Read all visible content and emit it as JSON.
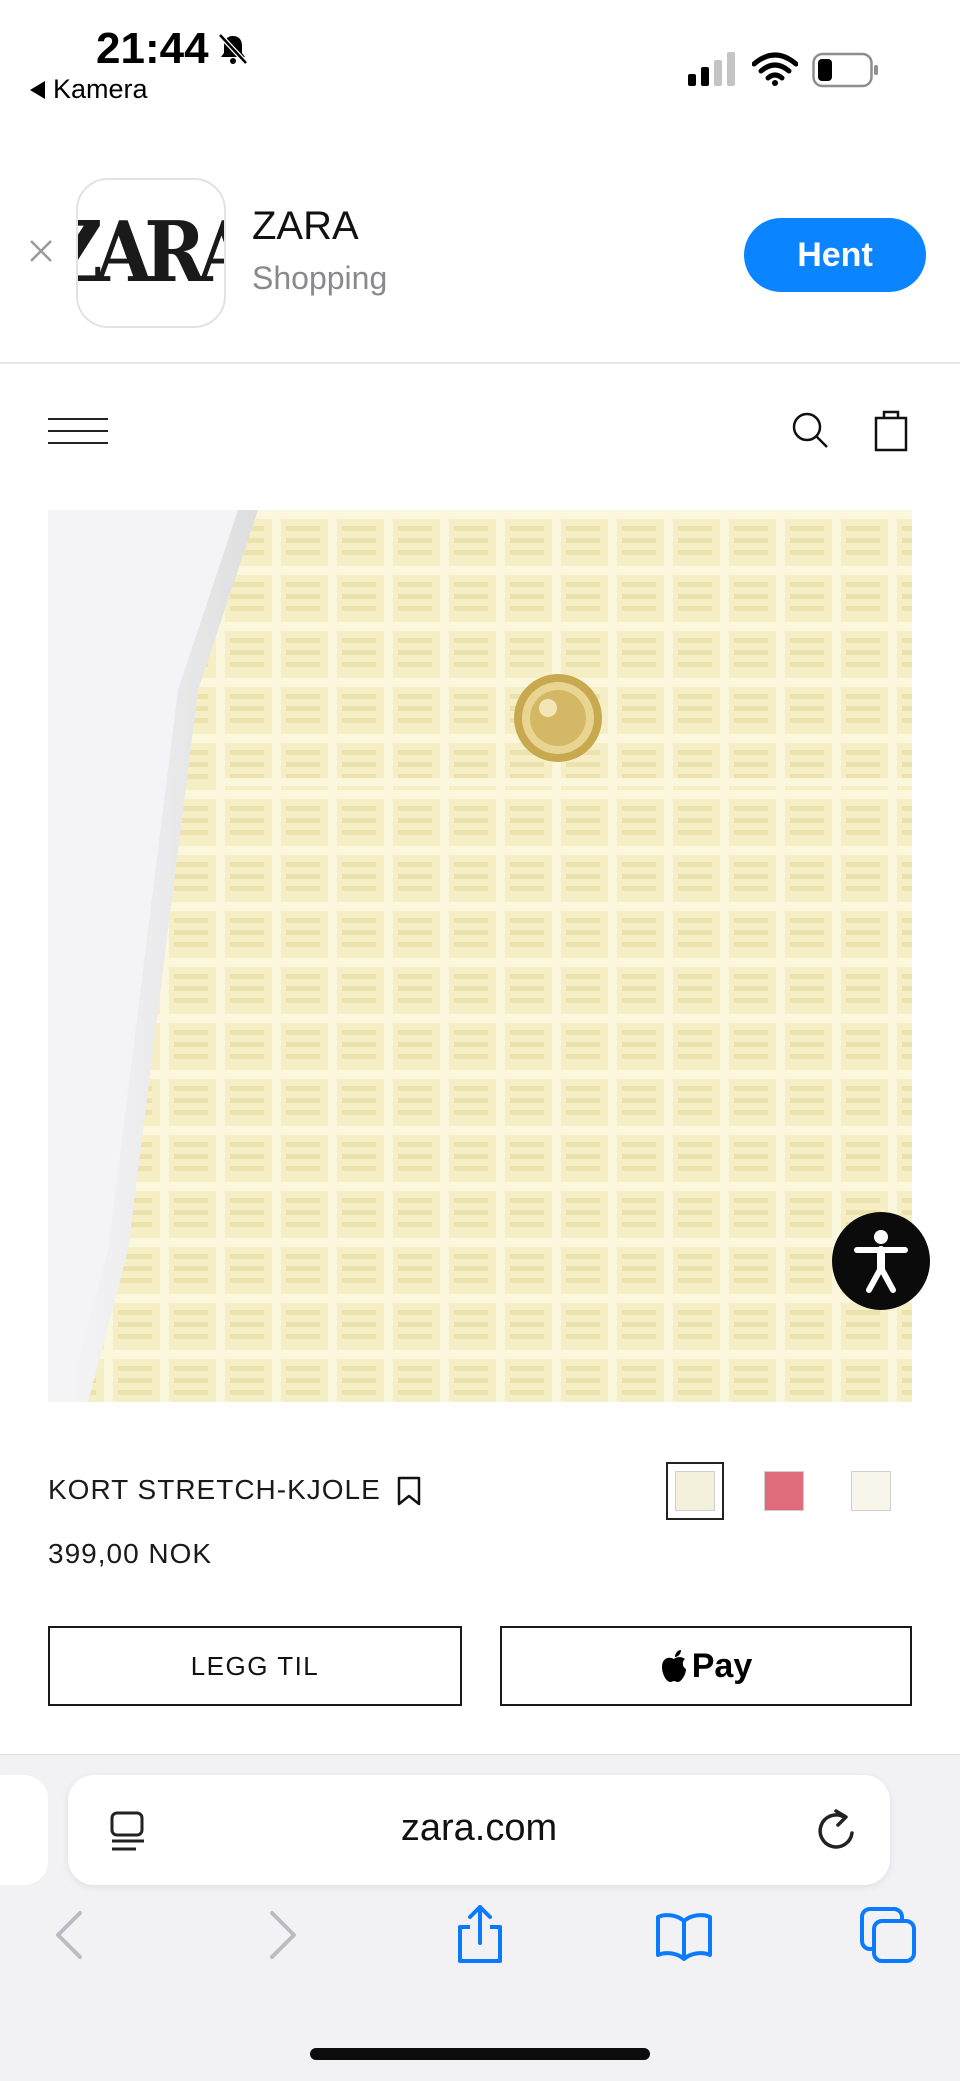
{
  "status_bar": {
    "time": "21:44",
    "back_label": "Kamera",
    "icons": [
      "bell-slash-icon",
      "cellular-signal-icon",
      "wifi-icon",
      "battery-low-icon"
    ]
  },
  "app_banner": {
    "logo_text": "ZARA",
    "app_name": "ZARA",
    "category": "Shopping",
    "get_label": "Hent",
    "accent": "#0a84ff"
  },
  "site_header": {
    "icons": [
      "hamburger-menu-icon",
      "search-icon",
      "shopping-bag-icon"
    ]
  },
  "product": {
    "name": "KORT STRETCH-KJOLE",
    "price": "399,00 NOK",
    "swatches": [
      {
        "color": "#f3f0dc",
        "selected": true
      },
      {
        "color": "#e06b7b",
        "selected": false
      },
      {
        "color": "#f8f5ea",
        "selected": false
      }
    ],
    "add_label": "LEGG TIL",
    "pay_label": "Pay",
    "fabric_color": "#f6efc6"
  },
  "browser": {
    "url": "zara.com",
    "toolbar": [
      "back-icon",
      "forward-icon",
      "share-icon",
      "bookmarks-icon",
      "tabs-icon"
    ],
    "accent": "#0a7aff"
  }
}
